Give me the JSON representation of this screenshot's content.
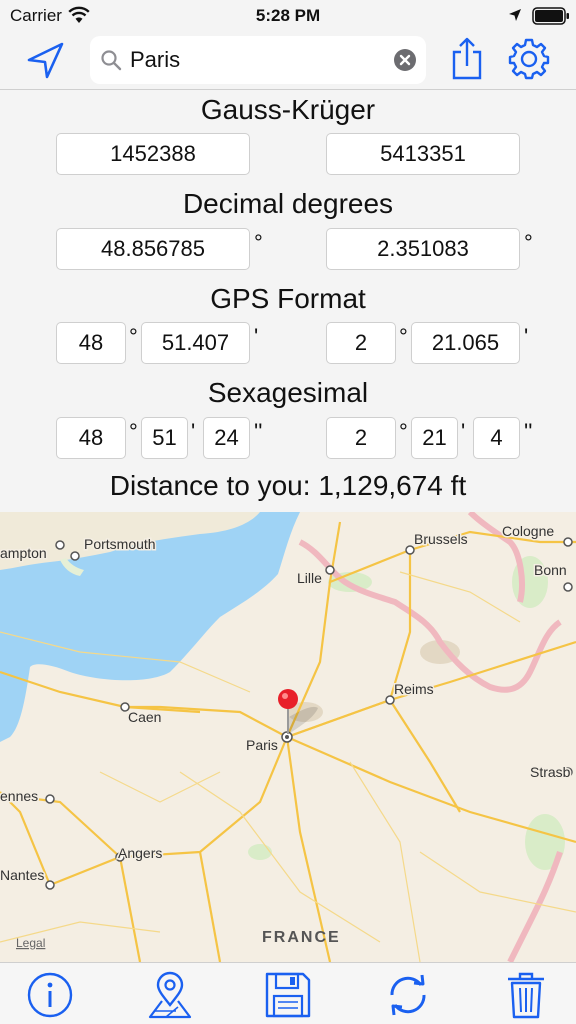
{
  "status_bar": {
    "carrier": "Carrier",
    "time": "5:28 PM"
  },
  "search": {
    "value": "Paris"
  },
  "sections": {
    "gauss_kruger": {
      "title": "Gauss-Krüger",
      "left": "1452388",
      "right": "5413351"
    },
    "decimal_degrees": {
      "title": "Decimal degrees",
      "lat": "48.856785",
      "lon": "2.351083",
      "unit": "°"
    },
    "gps_format": {
      "title": "GPS Format",
      "lat_deg": "48",
      "lat_min": "51.407",
      "lon_deg": "2",
      "lon_min": "21.065",
      "deg_unit": "°",
      "min_unit": "'"
    },
    "sexagesimal": {
      "title": "Sexagesimal",
      "lat_deg": "48",
      "lat_min": "51",
      "lat_sec": "24",
      "lon_deg": "2",
      "lon_min": "21",
      "lon_sec": "4",
      "deg_unit": "°",
      "min_unit": "'",
      "sec_unit": "''"
    }
  },
  "distance": "Distance to you: 1,129,674 ft",
  "map": {
    "cities": [
      "Portsmouth",
      "ampton",
      "Brussels",
      "Cologne",
      "Lille",
      "Bonn",
      "Reims",
      "Caen",
      "Paris",
      "ennes",
      "Angers",
      "Strasb",
      "Nantes"
    ],
    "country": "FRANCE",
    "legal": "Legal"
  },
  "colors": {
    "accent": "#1a60f0",
    "sea": "#9fd3f5",
    "land": "#f4eee3",
    "road": "#f5c445",
    "pin": "#e8202a"
  },
  "tab_bar": {
    "icons": [
      "info-icon",
      "map-pin-icon",
      "floppy-disk-icon",
      "refresh-icon",
      "trash-icon"
    ]
  }
}
